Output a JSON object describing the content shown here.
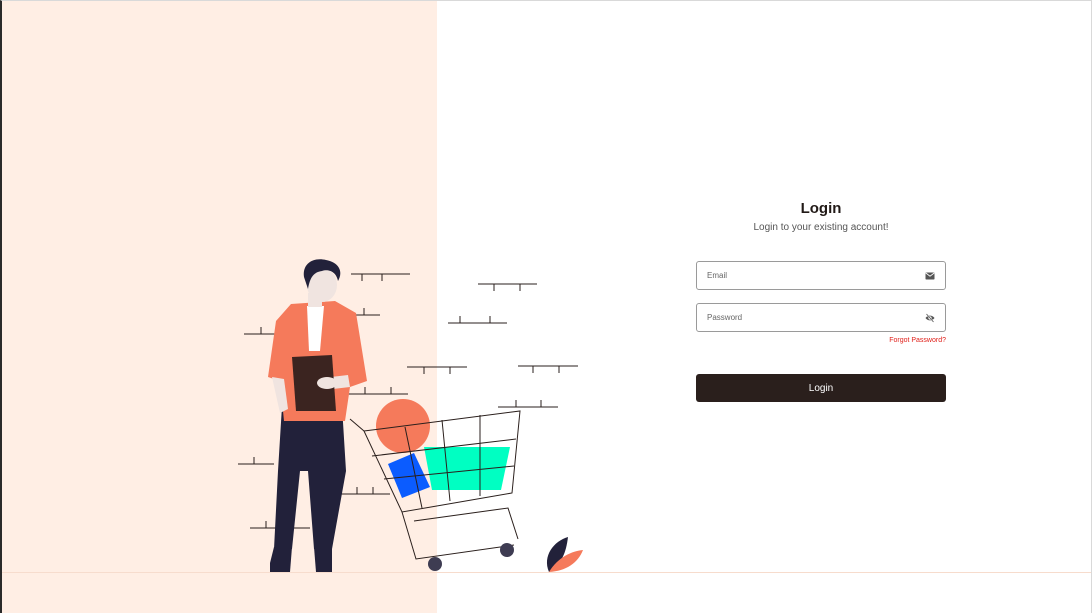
{
  "login": {
    "title": "Login",
    "subtitle": "Login to your existing account!",
    "email_placeholder": "Email",
    "password_placeholder": "Password",
    "forgot_password": "Forgot Password?",
    "submit_label": "Login",
    "email_icon": "envelope-icon",
    "password_icon": "eye-slash-icon"
  },
  "colors": {
    "panel_background": "#ffeee4",
    "accent_orange": "#f57a5b",
    "dark": "#2a1f1c",
    "navy": "#22213a",
    "teal": "#00ffc2",
    "blue": "#0b5cff",
    "link_red": "#e0201a"
  },
  "illustration": {
    "subject": "person-with-shopping-cart"
  }
}
